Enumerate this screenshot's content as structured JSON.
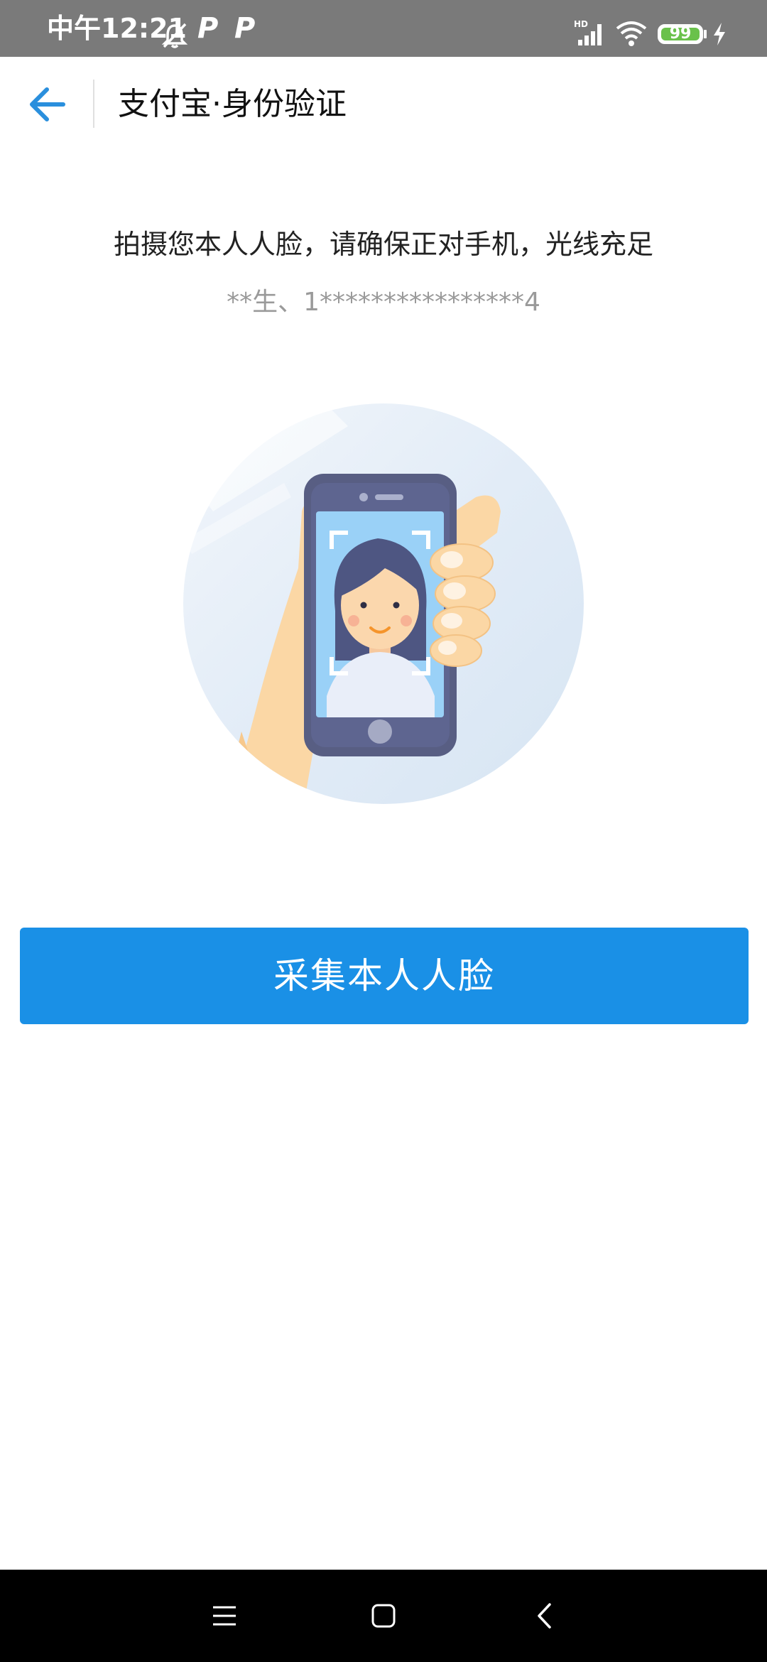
{
  "status_bar": {
    "time": "中午12:21",
    "battery_level": "99",
    "network_label": "HD",
    "icons": [
      "alarm-off-icon",
      "parking-p-icon",
      "parking-p-icon",
      "signal-icon",
      "wifi-icon",
      "battery-icon",
      "charging-bolt-icon"
    ],
    "p_glyph": "P"
  },
  "header": {
    "title": "支付宝·身份验证",
    "back_icon": "arrow-left-icon"
  },
  "content": {
    "instruction": "拍摄您本人人脸，请确保正对手机，光线充足",
    "user_id": "**生、1****************4",
    "illustration_icon": "face-capture-phone-illustration"
  },
  "primary_button": {
    "label": "采集本人人脸"
  },
  "nav_bar": {
    "icons": [
      "menu-icon",
      "home-icon",
      "back-icon"
    ]
  },
  "colors": {
    "accent": "#1a90e6",
    "status_bar_bg": "#7a7a7a",
    "battery_green": "#6ac14b"
  }
}
